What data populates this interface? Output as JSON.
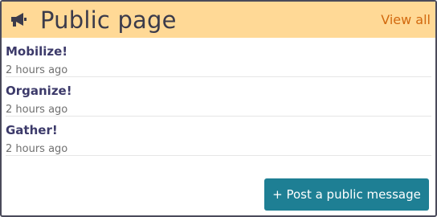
{
  "header": {
    "icon": "megaphone-icon",
    "title": "Public page",
    "view_all_label": "View all"
  },
  "items": [
    {
      "title": "Mobilize!",
      "time": "2 hours ago"
    },
    {
      "title": "Organize!",
      "time": "2 hours ago"
    },
    {
      "title": "Gather!",
      "time": "2 hours ago"
    }
  ],
  "actions": {
    "post_label": "+ Post a public message"
  },
  "colors": {
    "header_bg": "#ffd996",
    "link": "#d2690e",
    "title": "#3c3a6a",
    "button": "#1e7f94"
  }
}
